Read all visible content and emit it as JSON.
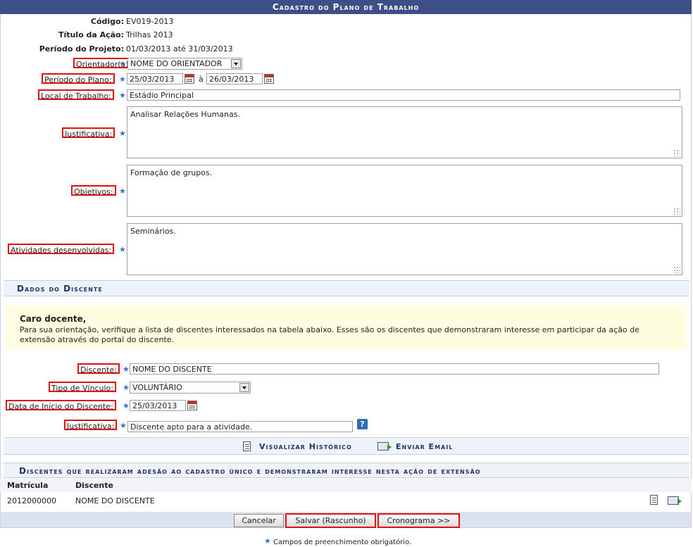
{
  "header": {
    "title": "Cadastro do Plano de Trabalho"
  },
  "info": {
    "codigo_label": "Código:",
    "codigo_value": "EV019-2013",
    "titulo_label": "Título da Ação:",
    "titulo_value": "Trilhas 2013",
    "periodo_label": "Período do Projeto:",
    "periodo_value": "01/03/2013 até 31/03/2013"
  },
  "plan": {
    "orientador_label": "Orientador(a):",
    "orientador_value": "NOME DO ORIENTADOR",
    "periodo_plano_label": "Período do Plano:",
    "periodo_inicio": "25/03/2013",
    "periodo_sep": "à",
    "periodo_fim": "26/03/2013",
    "local_label": "Local de Trabalho:",
    "local_value": "Estádio Principal",
    "justificativa_label": "Justificativa:",
    "justificativa_value": "Analisar Relações Humanas.",
    "objetivos_label": "Objetivos:",
    "objetivos_value": "Formação de grupos.",
    "atividades_label": "Atividades desenvolvidas:",
    "atividades_value": "Seminários."
  },
  "discente_section": {
    "title": "Dados do Discente",
    "notice_title": "Caro docente,",
    "notice_text": "Para sua orientação, verifique a lista de discentes interessados na tabela abaixo. Esses são os discentes que demonstraram interesse em participar da ação de extensão através do portal do discente.",
    "discente_label": "Discente:",
    "discente_value": "NOME DO DISCENTE",
    "vinculo_label": "Tipo de Vínculo:",
    "vinculo_value": "VOLUNTÁRIO",
    "data_label": "Data de Início do Discente:",
    "data_value": "25/03/2013",
    "justificativa_label": "Justificativa:",
    "justificativa_value": "Discente apto para a atividade.",
    "help_symbol": "?",
    "visualizar_historico": "Visualizar Histórico",
    "enviar_email": "Enviar Email"
  },
  "adesao_section": {
    "title": "Discentes que realizaram adesão ao cadastro único e demonstraram interesse nesta ação de extensão",
    "columns": [
      "Matrícula",
      "Discente"
    ],
    "rows": [
      {
        "matricula": "2012000000",
        "discente": "NOME DO DISCENTE"
      }
    ]
  },
  "buttons": {
    "cancelar": "Cancelar",
    "salvar": "Salvar (Rascunho)",
    "cronograma": "Cronograma >>"
  },
  "footer": {
    "required_star": "★",
    "required_note": "Campos de preenchimento obrigatório."
  }
}
